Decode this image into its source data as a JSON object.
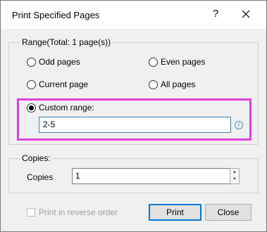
{
  "dialog": {
    "title": "Print Specified Pages",
    "help_glyph": "?",
    "close_icon": "close-icon"
  },
  "range": {
    "legend": "Range(Total: 1 page(s))",
    "options": {
      "odd": "Odd pages",
      "even": "Even pages",
      "current": "Current page",
      "all": "All pages",
      "custom": "Custom range:"
    },
    "selected": "custom",
    "custom_value": "2-5",
    "info_glyph": "i"
  },
  "copies": {
    "legend": "Copies:",
    "label": "Copies",
    "value": "1",
    "up_glyph": "▲",
    "down_glyph": "▼"
  },
  "reverse_order": {
    "label": "Print in reverse order",
    "checked": false,
    "enabled": false
  },
  "buttons": {
    "print": "Print",
    "close": "Close"
  },
  "colors": {
    "highlight": "#e040e0",
    "primary_border": "#0078d7",
    "dialog_bg": "#f0f0f0"
  }
}
